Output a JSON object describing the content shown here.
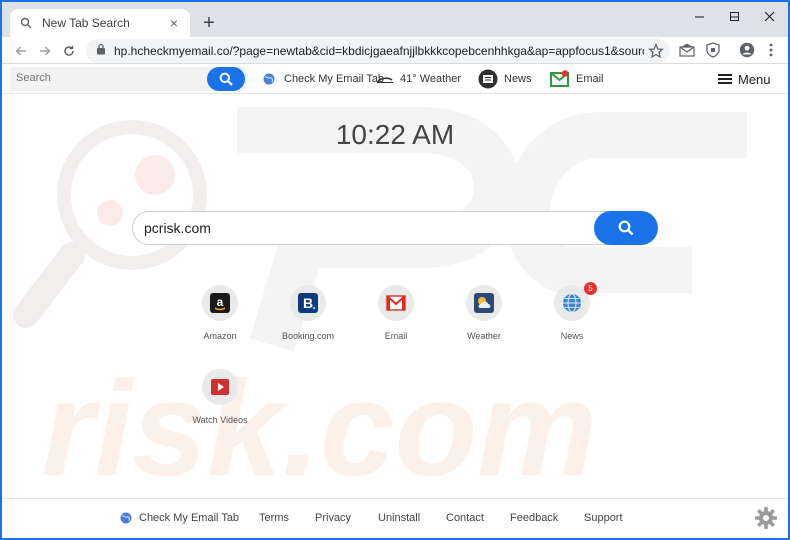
{
  "browser": {
    "tab_title": "New Tab Search",
    "tab_close": "×",
    "new_tab": "+",
    "url": "hp.hcheckmyemail.co/?page=newtab&cid=kbdicjgaeafnjjlbkkkcopebcenhhkga&ap=appfocus1&source=-lp0-ds..."
  },
  "header": {
    "search_placeholder": "Search",
    "links": [
      {
        "label": "Check My Email Tab",
        "icon": "globe-icon"
      },
      {
        "label": "41° Weather",
        "icon": "weather-icon"
      },
      {
        "label": "News",
        "icon": "news-icon"
      },
      {
        "label": "Email",
        "icon": "email-icon"
      }
    ],
    "menu_label": "Menu"
  },
  "main": {
    "time": "10:22 AM",
    "search_value": "pcrisk.com",
    "tiles": [
      {
        "label": "Amazon",
        "icon": "amazon-icon"
      },
      {
        "label": "Booking.com",
        "icon": "booking-icon"
      },
      {
        "label": "Email",
        "icon": "gmail-icon"
      },
      {
        "label": "Weather",
        "icon": "weather-tile-icon"
      },
      {
        "label": "News",
        "icon": "news-globe-icon",
        "badge": "5"
      },
      {
        "label": "Watch Videos",
        "icon": "youtube-icon"
      }
    ]
  },
  "footer": {
    "brand": "Check My Email Tab",
    "links": [
      "Terms",
      "Privacy",
      "Uninstall",
      "Contact",
      "Feedback",
      "Support"
    ]
  },
  "colors": {
    "accent": "#1a73e8",
    "tab_bar": "#dee1e6",
    "tile_bg": "#e9e9e9",
    "badge": "#e8302f"
  }
}
